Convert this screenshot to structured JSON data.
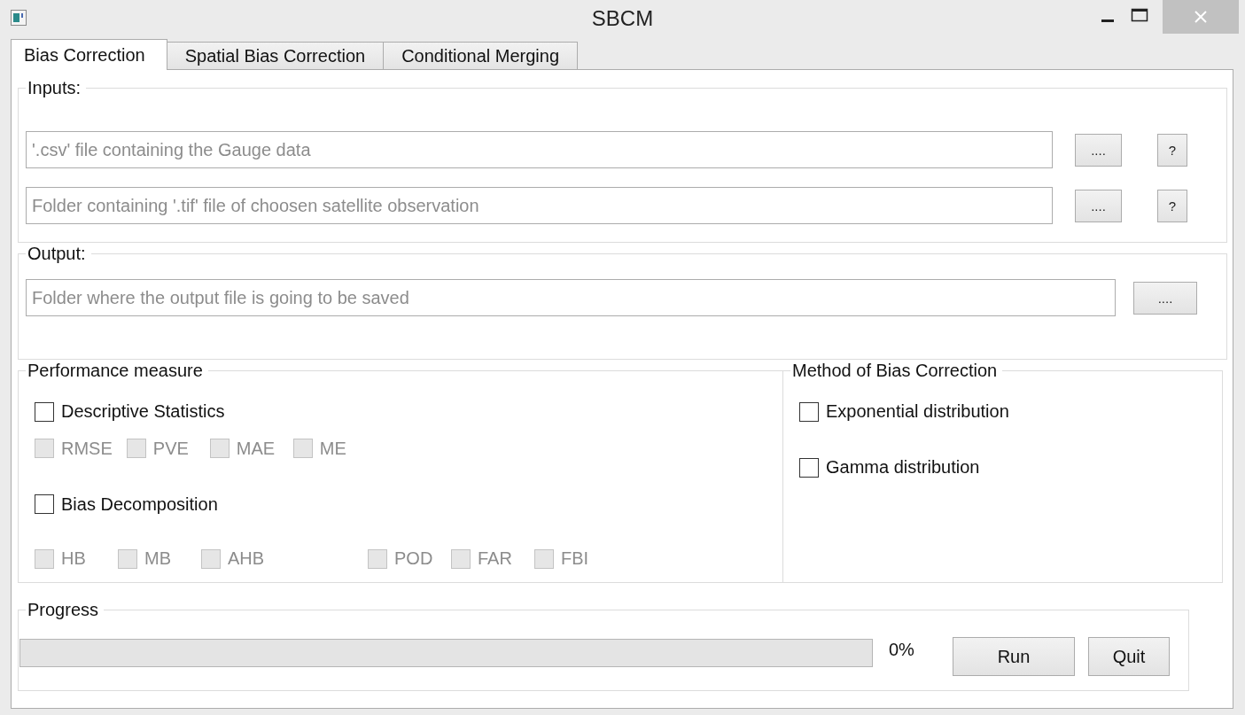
{
  "window": {
    "title": "SBCM"
  },
  "tabs": [
    {
      "label": "Bias Correction",
      "selected": true
    },
    {
      "label": "Spatial Bias Correction",
      "selected": false
    },
    {
      "label": "Conditional Merging",
      "selected": false
    }
  ],
  "inputs": {
    "title": "Inputs:",
    "rows": [
      {
        "placeholder": "'.csv' file containing the Gauge data",
        "browse_label": "....",
        "help_label": "?"
      },
      {
        "placeholder": "Folder containing '.tif' file of choosen satellite observation",
        "browse_label": "....",
        "help_label": "?"
      }
    ]
  },
  "output": {
    "title": "Output:",
    "rows": [
      {
        "placeholder": "Folder where the output file is going to be saved",
        "browse_label": "...."
      }
    ]
  },
  "performance_measure": {
    "title": "Performance measure",
    "sections": [
      {
        "label": "Descriptive Statistics",
        "checked": false,
        "option_groups": [
          [
            {
              "label": "RMSE",
              "checked": false,
              "disabled": true
            },
            {
              "label": "PVE",
              "checked": false,
              "disabled": true
            },
            {
              "label": "MAE",
              "checked": false,
              "disabled": true
            },
            {
              "label": "ME",
              "checked": false,
              "disabled": true
            }
          ]
        ]
      },
      {
        "label": "Bias Decomposition",
        "checked": false,
        "option_groups": [
          [
            {
              "label": "HB",
              "checked": false,
              "disabled": true
            },
            {
              "label": "MB",
              "checked": false,
              "disabled": true
            },
            {
              "label": "AHB",
              "checked": false,
              "disabled": true
            }
          ],
          [
            {
              "label": "POD",
              "checked": false,
              "disabled": true
            },
            {
              "label": "FAR",
              "checked": false,
              "disabled": true
            },
            {
              "label": "FBI",
              "checked": false,
              "disabled": true
            }
          ]
        ]
      }
    ]
  },
  "bias_method": {
    "title": "Method of Bias Correction",
    "options": [
      {
        "label": "Exponential distribution",
        "checked": false
      },
      {
        "label": "Gamma distribution",
        "checked": false
      }
    ]
  },
  "progress": {
    "title": "Progress",
    "level": 0,
    "reading": "0%",
    "buttons": [
      "Run",
      "Quit"
    ]
  }
}
